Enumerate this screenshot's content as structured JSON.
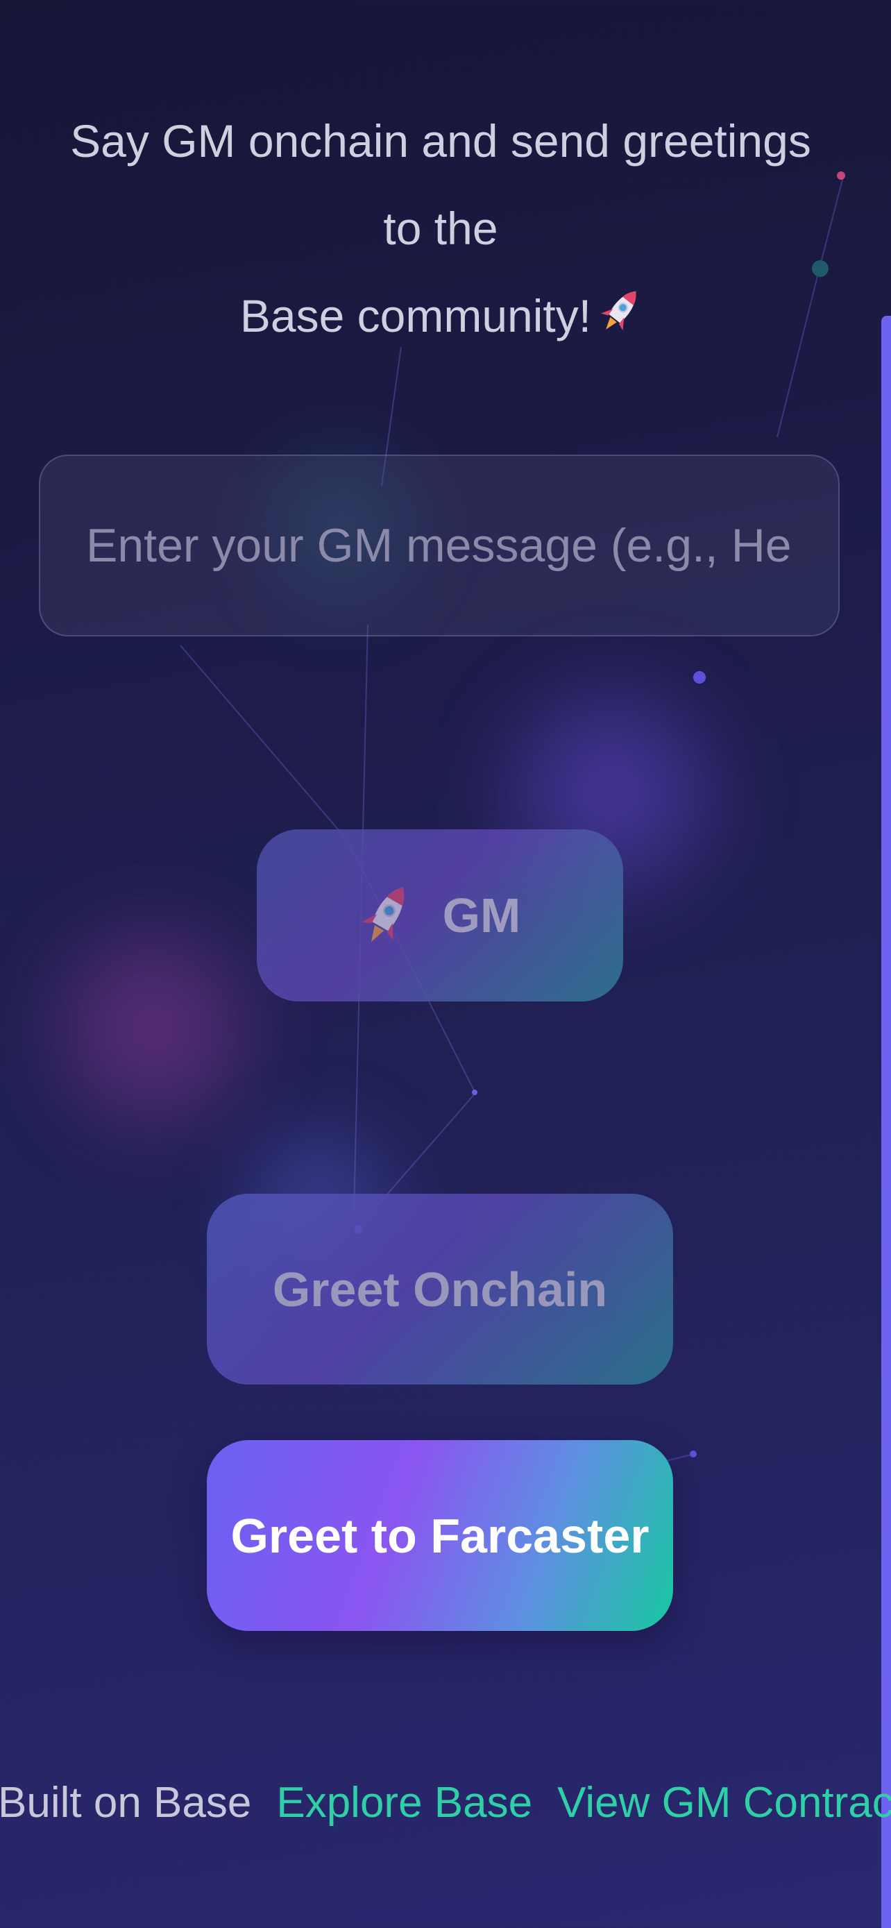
{
  "tagline": {
    "line1": "Say GM onchain and send greetings to the",
    "line2": "Base community!"
  },
  "message_input": {
    "value": "",
    "placeholder": "Enter your GM message (e.g., Hello Base"
  },
  "buttons": {
    "gm_label": "GM",
    "greet_onchain_label": "Greet Onchain",
    "greet_farcaster_label": "Greet to Farcaster"
  },
  "footer": {
    "built_on": "Built on Base",
    "explore_link": "Explore Base",
    "contract_link": "View GM Contract"
  },
  "icons": {
    "tagline": "rocket-icon",
    "gm_button": "rocket-icon",
    "footer": "rocket-icon"
  },
  "colors": {
    "background_top": "#171637",
    "background_bottom": "#2a2870",
    "link": "#2fd0a6",
    "accent_strip": "#6d63f0",
    "farcaster_gradient_start": "#6a62f2",
    "farcaster_gradient_end": "#17c8a0"
  }
}
